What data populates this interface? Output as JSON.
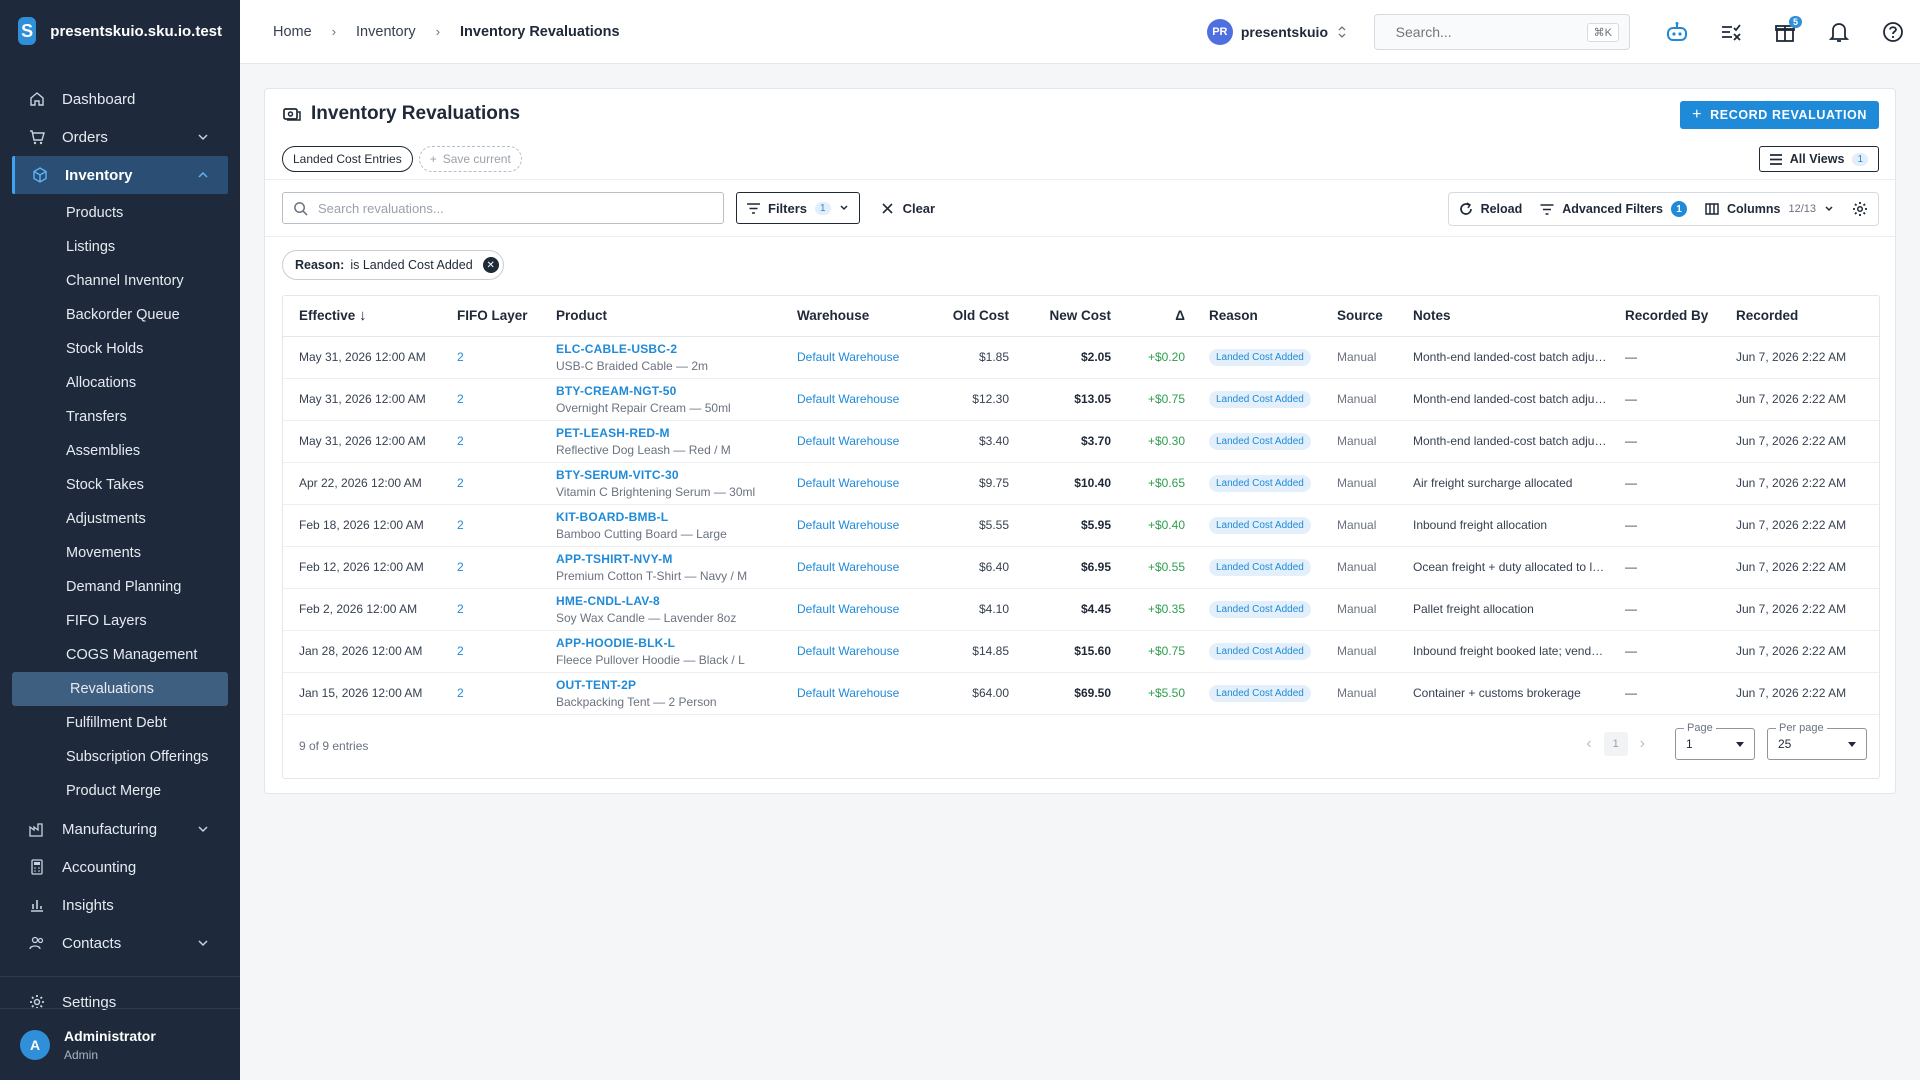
{
  "brand": {
    "name": "presentskuio.sku.io.test"
  },
  "sidebar": {
    "items": [
      {
        "label": "Dashboard",
        "icon": "home-icon"
      },
      {
        "label": "Orders",
        "icon": "cart-icon"
      },
      {
        "label": "Inventory",
        "icon": "box-icon"
      },
      {
        "label": "Manufacturing",
        "icon": "factory-icon"
      },
      {
        "label": "Accounting",
        "icon": "calculator-icon"
      },
      {
        "label": "Insights",
        "icon": "chart-icon"
      },
      {
        "label": "Contacts",
        "icon": "users-icon"
      },
      {
        "label": "Settings",
        "icon": "gear-icon"
      }
    ],
    "inventory_sub": [
      "Products",
      "Listings",
      "Channel Inventory",
      "Backorder Queue",
      "Stock Holds",
      "Allocations",
      "Transfers",
      "Assemblies",
      "Stock Takes",
      "Adjustments",
      "Movements",
      "Demand Planning",
      "FIFO Layers",
      "COGS Management",
      "Revaluations",
      "Fulfillment Debt",
      "Subscription Offerings",
      "Product Merge"
    ],
    "active_sub": "Revaluations"
  },
  "user": {
    "initial": "A",
    "name": "Administrator",
    "role": "Admin"
  },
  "topbar": {
    "breadcrumbs": [
      "Home",
      "Inventory",
      "Inventory Revaluations"
    ],
    "account": {
      "initials": "PR",
      "name": "presentskuio"
    },
    "search": {
      "placeholder": "Search...",
      "shortcut": "⌘K"
    },
    "gift_badge": "5"
  },
  "page": {
    "title": "Inventory Revaluations",
    "record_button": "RECORD REVALUATION",
    "view_chip": "Landed Cost Entries",
    "save_current": "Save current",
    "all_views": "All Views",
    "all_views_count": "1",
    "search_placeholder": "Search revaluations...",
    "filters_label": "Filters",
    "filters_count": "1",
    "clear_label": "Clear",
    "reload_label": "Reload",
    "advanced_filters_label": "Advanced Filters",
    "advanced_filters_count": "1",
    "columns_label": "Columns",
    "columns_count": "12/13",
    "filter_chip_key": "Reason:",
    "filter_chip_value": "is Landed Cost Added"
  },
  "table": {
    "headers": [
      "Effective",
      "FIFO Layer",
      "Product",
      "Warehouse",
      "Old Cost",
      "New Cost",
      "Δ",
      "Reason",
      "Source",
      "Notes",
      "Recorded By",
      "Recorded"
    ],
    "rows": [
      {
        "effective": "May 31, 2026 12:00 AM",
        "fifo": "2",
        "sku": "ELC-CABLE-USBC-2",
        "name": "USB-C Braided Cable — 2m",
        "warehouse": "Default Warehouse",
        "old": "$1.85",
        "new": "$2.05",
        "delta": "+$0.20",
        "reason": "Landed Cost Added",
        "source": "Manual",
        "notes": "Month-end landed-cost batch adjustment",
        "by": "—",
        "recorded": "Jun 7, 2026 2:22 AM"
      },
      {
        "effective": "May 31, 2026 12:00 AM",
        "fifo": "2",
        "sku": "BTY-CREAM-NGT-50",
        "name": "Overnight Repair Cream — 50ml",
        "warehouse": "Default Warehouse",
        "old": "$12.30",
        "new": "$13.05",
        "delta": "+$0.75",
        "reason": "Landed Cost Added",
        "source": "Manual",
        "notes": "Month-end landed-cost batch adjustment",
        "by": "—",
        "recorded": "Jun 7, 2026 2:22 AM"
      },
      {
        "effective": "May 31, 2026 12:00 AM",
        "fifo": "2",
        "sku": "PET-LEASH-RED-M",
        "name": "Reflective Dog Leash — Red / M",
        "warehouse": "Default Warehouse",
        "old": "$3.40",
        "new": "$3.70",
        "delta": "+$0.30",
        "reason": "Landed Cost Added",
        "source": "Manual",
        "notes": "Month-end landed-cost batch adjustment",
        "by": "—",
        "recorded": "Jun 7, 2026 2:22 AM"
      },
      {
        "effective": "Apr 22, 2026 12:00 AM",
        "fifo": "2",
        "sku": "BTY-SERUM-VITC-30",
        "name": "Vitamin C Brightening Serum — 30ml",
        "warehouse": "Default Warehouse",
        "old": "$9.75",
        "new": "$10.40",
        "delta": "+$0.65",
        "reason": "Landed Cost Added",
        "source": "Manual",
        "notes": "Air freight surcharge allocated",
        "by": "—",
        "recorded": "Jun 7, 2026 2:22 AM"
      },
      {
        "effective": "Feb 18, 2026 12:00 AM",
        "fifo": "2",
        "sku": "KIT-BOARD-BMB-L",
        "name": "Bamboo Cutting Board — Large",
        "warehouse": "Default Warehouse",
        "old": "$5.55",
        "new": "$5.95",
        "delta": "+$0.40",
        "reason": "Landed Cost Added",
        "source": "Manual",
        "notes": "Inbound freight allocation",
        "by": "—",
        "recorded": "Jun 7, 2026 2:22 AM"
      },
      {
        "effective": "Feb 12, 2026 12:00 AM",
        "fifo": "2",
        "sku": "APP-TSHIRT-NVY-M",
        "name": "Premium Cotton T-Shirt — Navy / M",
        "warehouse": "Default Warehouse",
        "old": "$6.40",
        "new": "$6.95",
        "delta": "+$0.55",
        "reason": "Landed Cost Added",
        "source": "Manual",
        "notes": "Ocean freight + duty allocated to layer",
        "by": "—",
        "recorded": "Jun 7, 2026 2:22 AM"
      },
      {
        "effective": "Feb 2, 2026 12:00 AM",
        "fifo": "2",
        "sku": "HME-CNDL-LAV-8",
        "name": "Soy Wax Candle — Lavender 8oz",
        "warehouse": "Default Warehouse",
        "old": "$4.10",
        "new": "$4.45",
        "delta": "+$0.35",
        "reason": "Landed Cost Added",
        "source": "Manual",
        "notes": "Pallet freight allocation",
        "by": "—",
        "recorded": "Jun 7, 2026 2:22 AM"
      },
      {
        "effective": "Jan 28, 2026 12:00 AM",
        "fifo": "2",
        "sku": "APP-HOODIE-BLK-L",
        "name": "Fleece Pullover Hoodie — Black / L",
        "warehouse": "Default Warehouse",
        "old": "$14.85",
        "new": "$15.60",
        "delta": "+$0.75",
        "reason": "Landed Cost Added",
        "source": "Manual",
        "notes": "Inbound freight booked late; vendor invoice",
        "by": "—",
        "recorded": "Jun 7, 2026 2:22 AM"
      },
      {
        "effective": "Jan 15, 2026 12:00 AM",
        "fifo": "2",
        "sku": "OUT-TENT-2P",
        "name": "Backpacking Tent — 2 Person",
        "warehouse": "Default Warehouse",
        "old": "$64.00",
        "new": "$69.50",
        "delta": "+$5.50",
        "reason": "Landed Cost Added",
        "source": "Manual",
        "notes": "Container + customs brokerage",
        "by": "—",
        "recorded": "Jun 7, 2026 2:22 AM"
      }
    ]
  },
  "footer": {
    "entries": "9 of 9 entries",
    "current_page": "1",
    "page_label": "Page",
    "page_value": "1",
    "per_page_label": "Per page",
    "per_page_value": "25"
  }
}
